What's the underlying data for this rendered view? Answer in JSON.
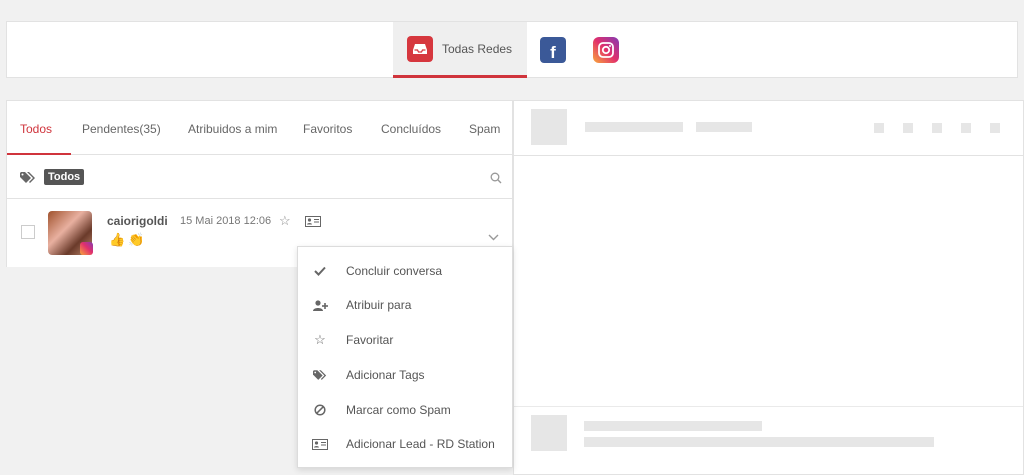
{
  "networks": {
    "all_label": "Todas Redes",
    "all_icon": "inbox-icon",
    "facebook_icon": "facebook-icon",
    "instagram_icon": "instagram-icon",
    "active": "Todas Redes",
    "accent_color": "#d0343c"
  },
  "filters": [
    {
      "label": "Todos",
      "active": true
    },
    {
      "label": "Pendentes(35)"
    },
    {
      "label": "Atribuidos a mim"
    },
    {
      "label": "Favoritos"
    },
    {
      "label": "Concluídos"
    },
    {
      "label": "Spam"
    }
  ],
  "tagbar": {
    "tag_label": "Todos",
    "tag_icon": "tags-icon",
    "search_icon": "search-icon"
  },
  "conversation": {
    "username": "caiorigoldi",
    "datetime": "15 Mai 2018 12:06",
    "preview": "👍👏",
    "network": "instagram"
  },
  "menu": {
    "items": [
      {
        "label": "Concluir conversa",
        "icon": "check-icon"
      },
      {
        "label": "Atribuir para",
        "icon": "user-plus-icon"
      },
      {
        "label": "Favoritar",
        "icon": "star-outline-icon"
      },
      {
        "label": "Adicionar Tags",
        "icon": "tags-icon"
      },
      {
        "label": "Marcar como Spam",
        "icon": "ban-icon"
      },
      {
        "label": "Adicionar Lead - RD Station",
        "icon": "id-card-icon"
      }
    ]
  }
}
